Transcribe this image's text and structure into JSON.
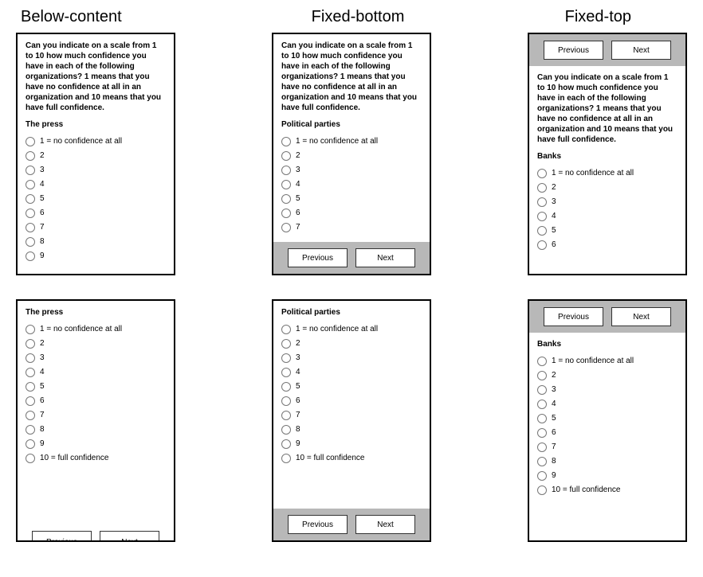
{
  "headings": {
    "below_content": "Below-content",
    "fixed_bottom": "Fixed-bottom",
    "fixed_top": "Fixed-top"
  },
  "question": "Can you indicate on a scale from 1 to 10 how much confidence you have in each of the following organizations?  1 means that you have no confidence at all in an organization and 10 means that you have full confidence.",
  "subjects": {
    "press": "The press",
    "parties": "Political parties",
    "banks": "Banks"
  },
  "options": {
    "o1": "1 = no confidence at all",
    "o2": "2",
    "o3": "3",
    "o4": "4",
    "o5": "5",
    "o6": "6",
    "o7": "7",
    "o8": "8",
    "o9": "9",
    "o10": "10 = full confidence"
  },
  "nav": {
    "prev": "Previous",
    "next": "Next"
  }
}
